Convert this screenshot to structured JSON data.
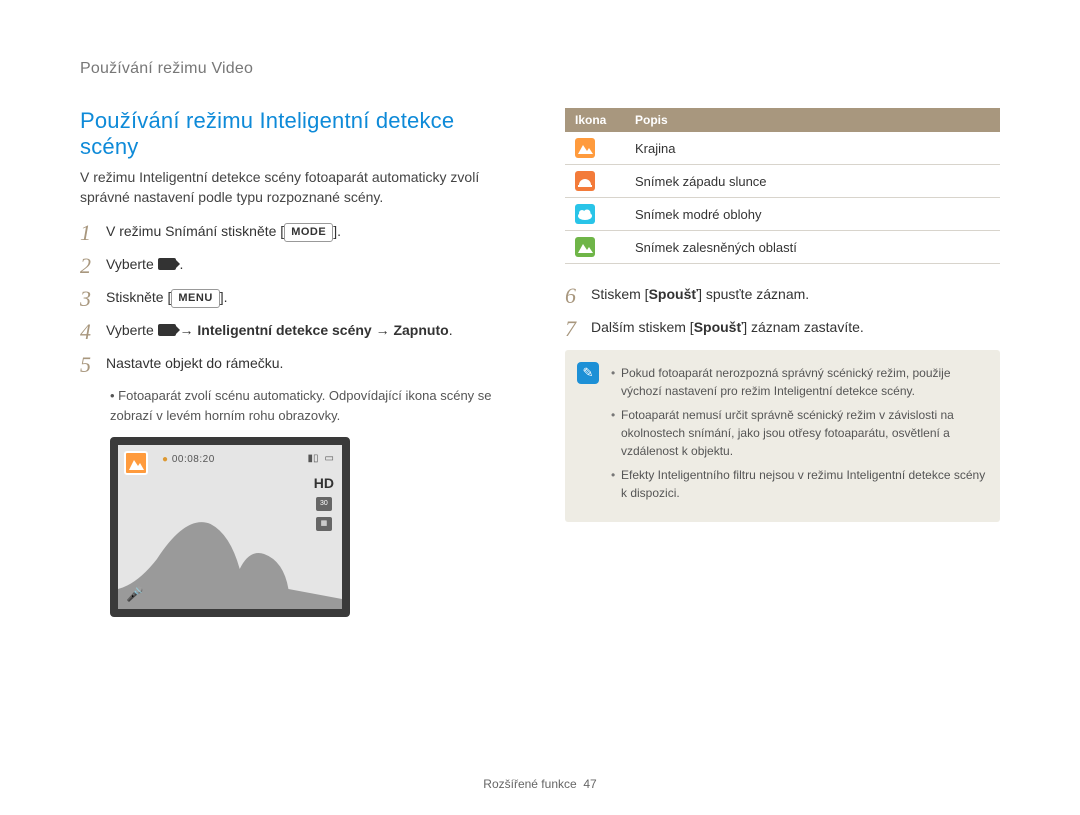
{
  "header": {
    "title": "Používání režimu Video"
  },
  "section": {
    "title": "Používání režimu Inteligentní detekce scény"
  },
  "intro": "V režimu Inteligentní detekce scény fotoaparát automaticky zvolí správné nastavení podle typu rozpoznané scény.",
  "steps": {
    "s1_pre": "V režimu Snímání stiskněte [",
    "s1_btn": "MODE",
    "s1_post": "].",
    "s2_pre": "Vyberte ",
    "s2_post": " .",
    "s3_pre": "Stiskněte [",
    "s3_btn": "MENU",
    "s3_post": "].",
    "s4_pre": "Vyberte ",
    "s4_bold": " → Inteligentní detekce scény → Zapnuto",
    "s4_post": ".",
    "s5": "Nastavte objekt do rámečku.",
    "s5_sub": "Fotoaparát zvolí scénu automaticky. Odpovídající ikona scény se zobrazí v levém horním rohu obrazovky.",
    "s6_pre": "Stiskem [",
    "s6_bold": "Spoušť",
    "s6_post": "] spusťte záznam.",
    "s7_pre": "Dalším stiskem [",
    "s7_bold": "Spoušť",
    "s7_post": "] záznam zastavíte."
  },
  "preview": {
    "timer_rec": "●",
    "timer_time": "00:08:20",
    "hd": "HD"
  },
  "table": {
    "col_icon": "Ikona",
    "col_desc": "Popis",
    "rows": [
      {
        "desc": "Krajina"
      },
      {
        "desc": "Snímek západu slunce"
      },
      {
        "desc": "Snímek modré oblohy"
      },
      {
        "desc": "Snímek zalesněných oblastí"
      }
    ]
  },
  "notes": {
    "n1": "Pokud fotoaparát nerozpozná správný scénický režim, použije výchozí nastavení pro režim Inteligentní detekce scény.",
    "n2": "Fotoaparát nemusí určit správně scénický režim v závislosti na okolnostech snímání, jako jsou otřesy fotoaparátu, osvětlení a vzdálenost k objektu.",
    "n3": "Efekty Inteligentního filtru nejsou v režimu Inteligentní detekce scény k dispozici."
  },
  "footer": {
    "section": "Rozšířené funkce",
    "page": "47"
  }
}
